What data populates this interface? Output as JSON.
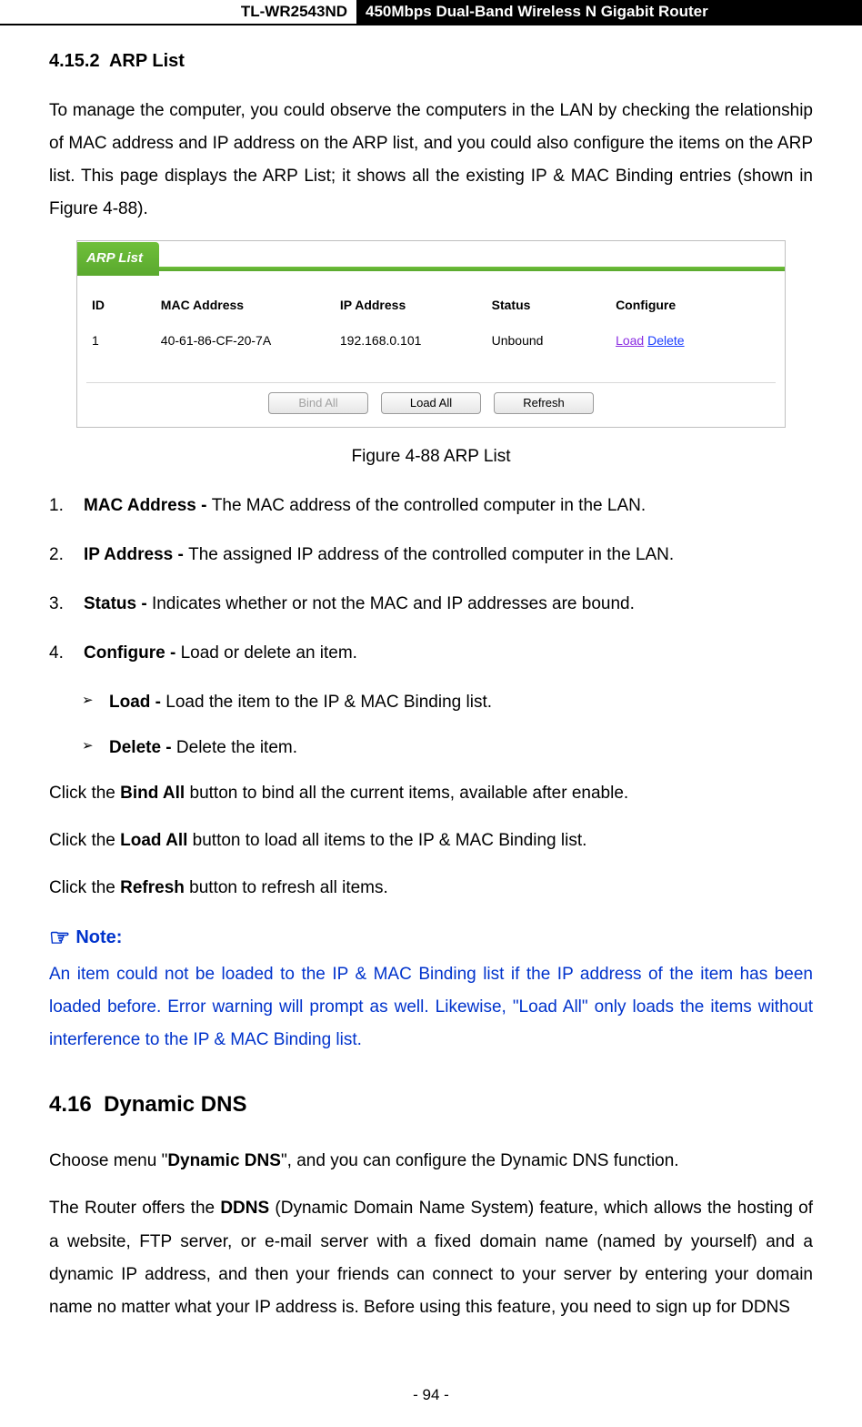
{
  "header": {
    "model": "TL-WR2543ND",
    "product": "450Mbps Dual-Band Wireless N Gigabit Router"
  },
  "section1": {
    "number": "4.15.2",
    "title": "ARP List",
    "intro": "To manage the computer, you could observe the computers in the LAN by checking the relationship of MAC address and IP address on the ARP list, and you could also configure the items on the ARP list. This page displays the ARP List; it shows all the existing IP & MAC Binding entries (shown in Figure 4-88)."
  },
  "arp_figure": {
    "tab": "ARP List",
    "headers": {
      "id": "ID",
      "mac": "MAC Address",
      "ip": "IP Address",
      "status": "Status",
      "configure": "Configure"
    },
    "row": {
      "id": "1",
      "mac": "40-61-86-CF-20-7A",
      "ip": "192.168.0.101",
      "status": "Unbound",
      "load": "Load",
      "delete": "Delete"
    },
    "buttons": {
      "bind_all": "Bind All",
      "load_all": "Load All",
      "refresh": "Refresh"
    },
    "caption": "Figure 4-88    ARP List"
  },
  "defs": [
    {
      "num": "1.",
      "term": "MAC Address - ",
      "text": "The MAC address of the controlled computer in the LAN."
    },
    {
      "num": "2.",
      "term": "IP Address - ",
      "text": "The assigned IP address of the controlled computer in the LAN."
    },
    {
      "num": "3.",
      "term": "Status - ",
      "text": "Indicates whether or not the MAC and IP addresses are bound."
    },
    {
      "num": "4.",
      "term": "Configure - ",
      "text": "Load or delete an item."
    }
  ],
  "subdefs": [
    {
      "term": "Load - ",
      "text": "Load the item to the IP & MAC Binding list."
    },
    {
      "term": "Delete - ",
      "text": "Delete the item."
    }
  ],
  "click_lines": [
    {
      "pre": "Click the ",
      "bold": "Bind All",
      "post": " button to bind all the current items, available after enable."
    },
    {
      "pre": "Click the ",
      "bold": "Load All",
      "post": " button to load all items to the IP & MAC Binding list."
    },
    {
      "pre": "Click the ",
      "bold": "Refresh",
      "post": " button to refresh all items."
    }
  ],
  "note": {
    "label": "Note:",
    "text": "An item could not be loaded to the IP & MAC Binding list if the IP address of the item has been loaded before. Error warning will prompt as well. Likewise, \"Load All\" only loads the items without interference to the IP & MAC Binding list."
  },
  "section2": {
    "number": "4.16",
    "title": "Dynamic DNS",
    "line1_pre": "Choose menu \"",
    "line1_bold": "Dynamic DNS",
    "line1_post": "\", and you can configure the Dynamic DNS function.",
    "para_pre": "The Router offers the ",
    "para_bold": "DDNS",
    "para_post": " (Dynamic Domain Name System) feature, which allows the hosting of a website, FTP server, or e-mail server with a fixed domain name (named by yourself) and a dynamic IP address, and then your friends can connect to your server by entering your domain name no matter what your IP address is. Before using this feature, you need to sign up for DDNS"
  },
  "page_number": "- 94 -"
}
